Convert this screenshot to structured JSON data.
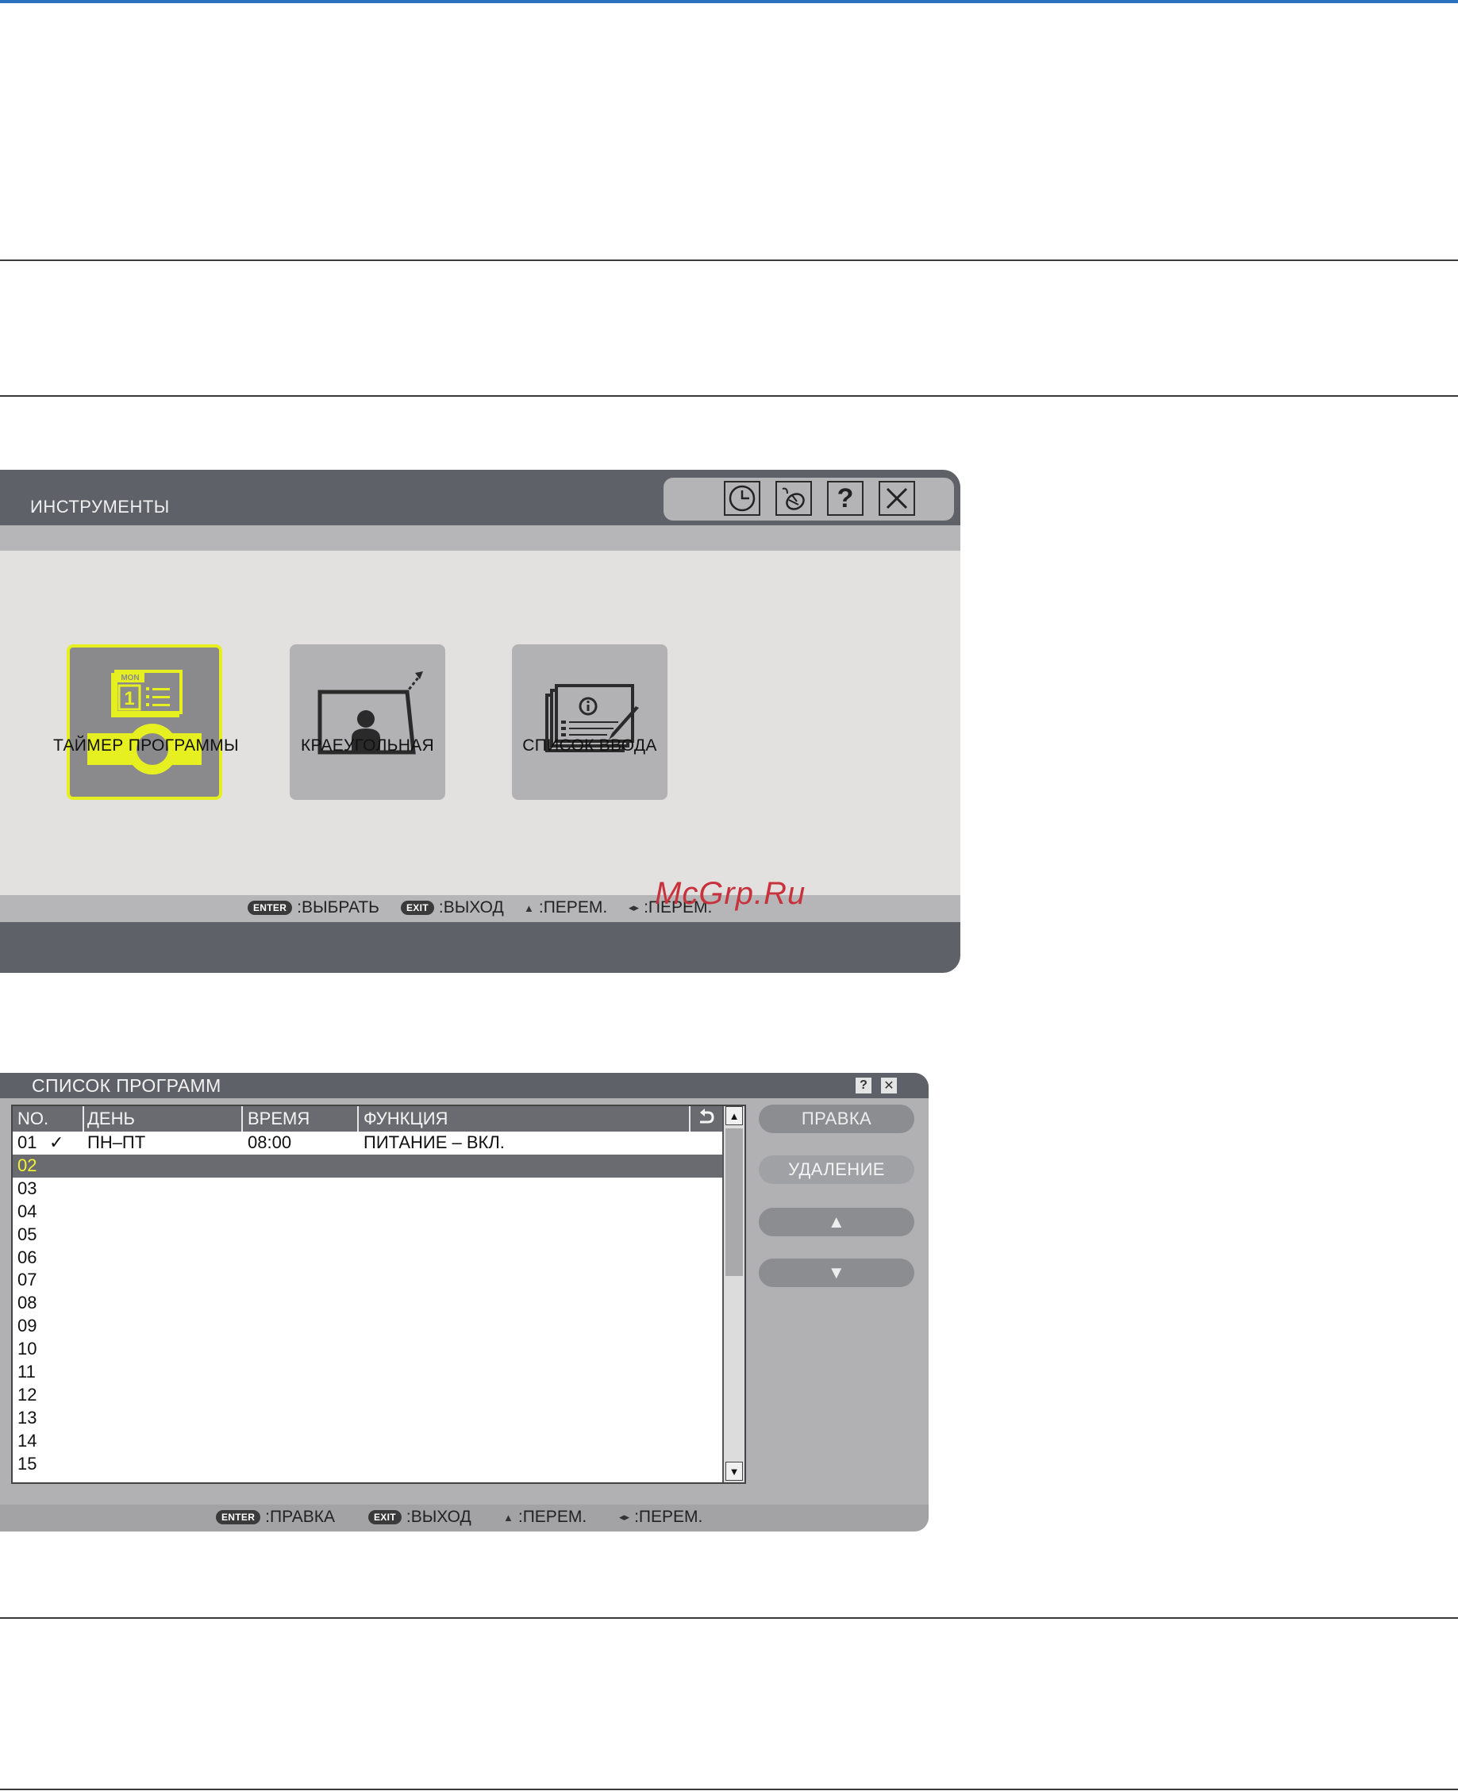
{
  "tools": {
    "title": "ИНСТРУМЕНТЫ",
    "icons": [
      "clock-icon",
      "mouse-icon",
      "help-icon",
      "close-icon"
    ],
    "help_glyph": "?",
    "items": [
      {
        "label": "ТАЙМЕР ПРОГРАММЫ",
        "icon": "program-timer-icon",
        "selected": true
      },
      {
        "label": "КРАЕУГОЛЬНАЯ",
        "icon": "cornerstone-icon",
        "selected": false
      },
      {
        "label": "СПИСОК ВВОДА",
        "icon": "input-list-icon",
        "selected": false
      }
    ],
    "calendar_day": "MON",
    "calendar_num": "1",
    "help": {
      "enter_key": "ENTER",
      "enter_text": ":ВЫБРАТЬ",
      "exit_key": "EXIT",
      "exit_text": ":ВЫХОД",
      "updown_text": ":ПЕРЕМ.",
      "leftright_text": ":ПЕРЕМ."
    }
  },
  "watermark": "McGrp.Ru",
  "program_list": {
    "title": "СПИСОК ПРОГРАММ",
    "help_glyph": "?",
    "close_glyph": "✕",
    "columns": {
      "no": "NO.",
      "day": "ДЕНЬ",
      "time": "ВРЕМЯ",
      "function": "ФУНКЦИЯ"
    },
    "rows": [
      {
        "no": "01",
        "check": "✓",
        "day": "ПН–ПТ",
        "time": "08:00",
        "function": "ПИТАНИЕ – ВКЛ."
      },
      {
        "no": "02"
      },
      {
        "no": "03"
      },
      {
        "no": "04"
      },
      {
        "no": "05"
      },
      {
        "no": "06"
      },
      {
        "no": "07"
      },
      {
        "no": "08"
      },
      {
        "no": "09"
      },
      {
        "no": "10"
      },
      {
        "no": "11"
      },
      {
        "no": "12"
      },
      {
        "no": "13"
      },
      {
        "no": "14"
      },
      {
        "no": "15"
      }
    ],
    "selected_row": "02",
    "buttons": {
      "edit": "ПРАВКА",
      "delete": "УДАЛЕНИЕ",
      "up": "▲",
      "down": "▼"
    },
    "scroll_up": "▲",
    "scroll_down": "▼",
    "help": {
      "enter_key": "ENTER",
      "enter_text": ":ПРАВКА",
      "exit_key": "EXIT",
      "exit_text": ":ВЫХОД",
      "updown_text": ":ПЕРЕМ.",
      "leftright_text": ":ПЕРЕМ."
    }
  },
  "colors": {
    "accent_blue": "#2a72c0",
    "selection_yellow": "#e6f020",
    "watermark_red": "#c8323c"
  }
}
